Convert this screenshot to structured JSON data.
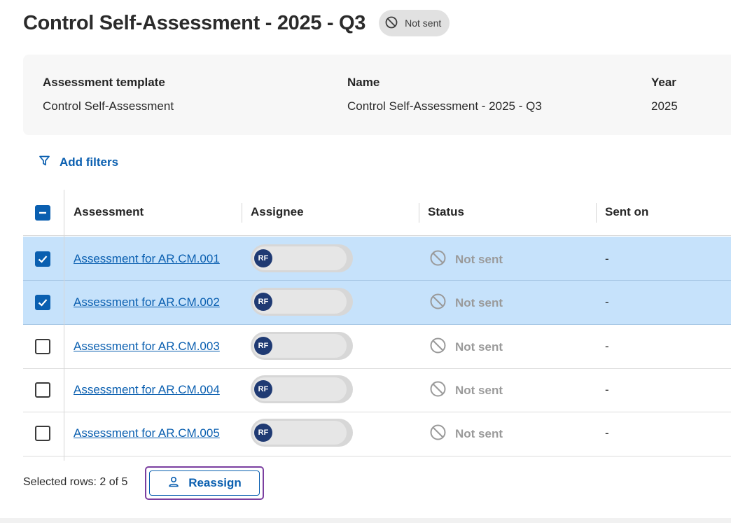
{
  "page": {
    "title": "Control Self-Assessment - 2025 - Q3",
    "status_badge": "Not sent",
    "status_icon": "not-sent-icon"
  },
  "details": {
    "template_label": "Assessment template",
    "template_value": "Control Self-Assessment",
    "name_label": "Name",
    "name_value": "Control Self-Assessment - 2025 - Q3",
    "year_label": "Year",
    "year_value": "2025"
  },
  "filters": {
    "add_label": "Add filters",
    "icon": "filter-icon"
  },
  "table": {
    "columns": [
      "Assessment",
      "Assignee",
      "Status",
      "Sent on"
    ],
    "header_checkbox": "indeterminate",
    "rows": [
      {
        "selected": true,
        "assessment": "Assessment for AR.CM.001",
        "assignee_initials": "RF",
        "status": "Not sent",
        "sent_on": "-"
      },
      {
        "selected": true,
        "assessment": "Assessment for AR.CM.002",
        "assignee_initials": "RF",
        "status": "Not sent",
        "sent_on": "-"
      },
      {
        "selected": false,
        "assessment": "Assessment for AR.CM.003",
        "assignee_initials": "RF",
        "status": "Not sent",
        "sent_on": "-"
      },
      {
        "selected": false,
        "assessment": "Assessment for AR.CM.004",
        "assignee_initials": "RF",
        "status": "Not sent",
        "sent_on": "-"
      },
      {
        "selected": false,
        "assessment": "Assessment for AR.CM.005",
        "assignee_initials": "RF",
        "status": "Not sent",
        "sent_on": "-"
      }
    ]
  },
  "footer": {
    "selected_rows": "Selected rows: 2 of 5",
    "reassign_label": "Reassign",
    "reassign_icon": "user-icon"
  },
  "colors": {
    "accent": "#0a5fb0",
    "selected_row": "#c6e2fb",
    "focus_ring": "#7b3fa0",
    "avatar": "#1f3a73"
  }
}
